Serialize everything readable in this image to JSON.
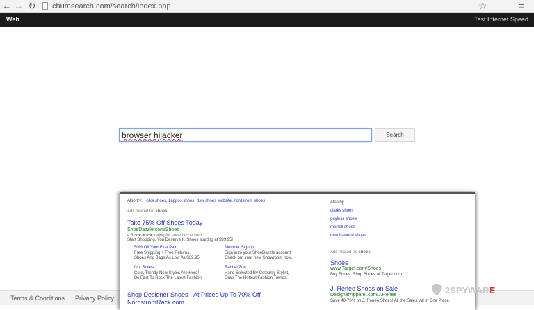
{
  "browser": {
    "url": "chumsearch.com/search/index.php"
  },
  "topbar": {
    "web_tab": "Web",
    "speed_link": "Test Internet Speed"
  },
  "search": {
    "query": "browser hijacker",
    "button_label": "Search"
  },
  "footer": {
    "terms": "Terms & Conditions",
    "privacy": "Privacy Policy"
  },
  "panel": {
    "also_try_label": "Also try:",
    "also_try_links": [
      "nike shoes",
      "zappos shoes",
      "dsw shoes website",
      "nordstrom shoes"
    ],
    "ads_related_label": "Ads related to:",
    "ads_related_term": "shoes",
    "ad1": {
      "title": "Take 75% Off Shoes Today",
      "display_url": "ShoeDazzle.com/Shoes",
      "rating_text": "4.5 ★★★★★ rating for shoedazzle.com",
      "desc": "Start Shopping, You Deserve It. Shoes starting at $39.95!",
      "sitelinks": [
        {
          "title": "50% Off Your First Pair",
          "line1": "Free Shipping + Free Returns.",
          "line2": "Shoes And Bags As Low As $39.95!"
        },
        {
          "title": "Member Sign In",
          "line1": "Sign in to your ShoeDazzle account.",
          "line2": "Check out your new Showroom now."
        },
        {
          "title": "Our Styles",
          "line1": "Cute, Trendy New Styles Are Here!",
          "line2": "Be First To Rock The Latest Fashion"
        },
        {
          "title": "Rachel Zoe",
          "line1": "Hand Selected By Celebrity Stylist,",
          "line2": "Grab The Hottest Fashion Trends."
        }
      ]
    },
    "ad2": {
      "title": "Shop Designer Shoes - At Prices Up To 70% Off -",
      "title2": "NordstromRack.com"
    },
    "right": {
      "also_by_label": "Also by",
      "also_by_links": [
        "clarks shoes",
        "payless shoes",
        "merrell shoes",
        "new balance shoes"
      ],
      "ads_related_label": "Ads related to:",
      "ads_related_term": "shoes",
      "ad1": {
        "title": "Shoes",
        "display_url": "www.Target.com/Shoes",
        "desc": "Buy Shoes. Shop Shoes at Target.com."
      },
      "ad2": {
        "title": "J. Renee Shoes on Sale",
        "display_url": "DesignerApparel.com/J.Renee",
        "desc": "Save 40-70% on J. Renee Shoes! All the Sales, All in One Place."
      }
    }
  },
  "watermark": {
    "prefix": "2SPYWAR",
    "suffix": "E"
  }
}
